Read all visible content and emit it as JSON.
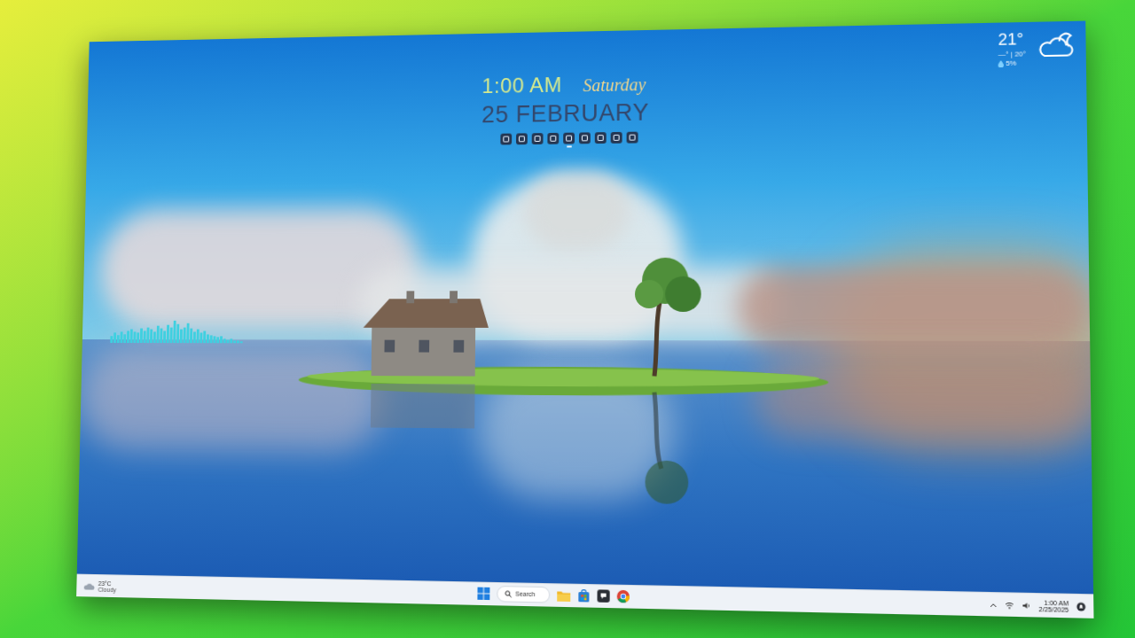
{
  "clock": {
    "time": "1:00 AM",
    "day": "Saturday",
    "date": "25 FEBRUARY"
  },
  "launcher": [
    {
      "selected": false
    },
    {
      "selected": false
    },
    {
      "selected": false
    },
    {
      "selected": false
    },
    {
      "selected": true
    },
    {
      "selected": false
    },
    {
      "selected": false
    },
    {
      "selected": false
    },
    {
      "selected": false
    }
  ],
  "weather_widget": {
    "temperature": "21°",
    "range": "—° | 20°",
    "rain": "5%"
  },
  "visualizer": {
    "levels": [
      0.3,
      0.45,
      0.35,
      0.5,
      0.4,
      0.55,
      0.6,
      0.5,
      0.45,
      0.65,
      0.55,
      0.7,
      0.6,
      0.5,
      0.75,
      0.65,
      0.55,
      0.8,
      0.7,
      1.0,
      0.85,
      0.6,
      0.7,
      0.9,
      0.65,
      0.5,
      0.6,
      0.45,
      0.55,
      0.4,
      0.35,
      0.3,
      0.25,
      0.3,
      0.2,
      0.15,
      0.2,
      0.1,
      0.12,
      0.08
    ]
  },
  "taskbar": {
    "weather": {
      "temperature": "23°C",
      "condition": "Cloudy"
    },
    "search": {
      "label": "Search"
    },
    "clock": {
      "time": "1:00 AM",
      "date": "2/25/2025"
    }
  }
}
